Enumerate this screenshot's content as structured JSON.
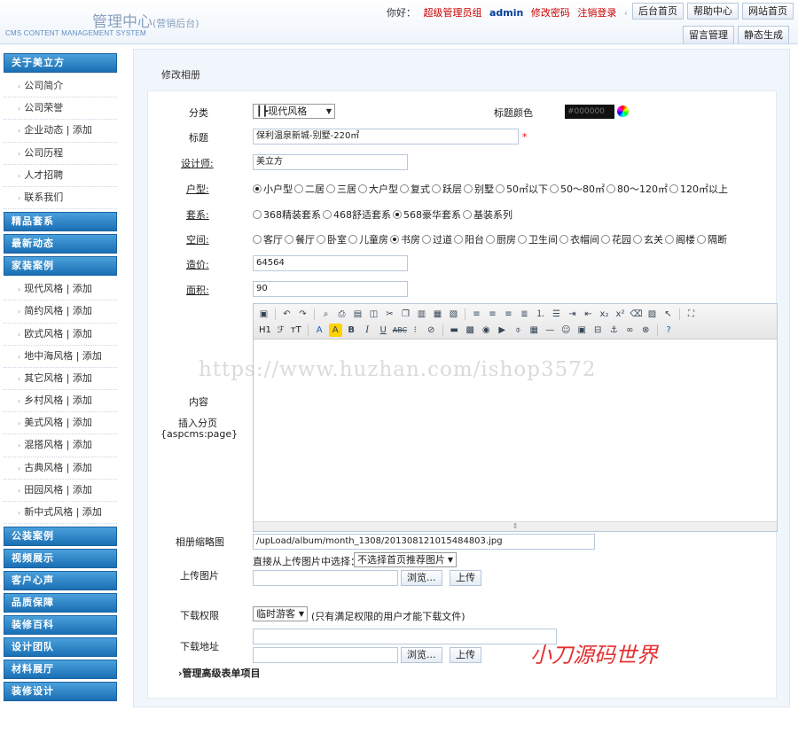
{
  "header": {
    "title": "管理中心",
    "title_sub": "(营销后台)",
    "title_en": "CMS CONTENT MANAGEMENT SYSTEM",
    "greeting": "你好：",
    "user_group": "超级管理员组",
    "user_name": "admin",
    "change_password": "修改密码",
    "logout": "注销登录",
    "top_buttons": [
      "后台首页",
      "帮助中心",
      "网站首页"
    ],
    "sub_buttons": [
      "留言管理",
      "静态生成"
    ]
  },
  "sidebar": {
    "groups": [
      {
        "title": "关于美立方",
        "items": [
          "公司简介",
          "公司荣誉",
          "企业动态 | 添加",
          "公司历程",
          "人才招聘",
          "联系我们"
        ]
      },
      {
        "title": "精品套系",
        "items": []
      },
      {
        "title": "最新动态",
        "items": []
      },
      {
        "title": "家装案例",
        "items": [
          "现代风格 | 添加",
          "简约风格 | 添加",
          "欧式风格 | 添加",
          "地中海风格 | 添加",
          "其它风格 | 添加",
          "乡村风格 | 添加",
          "美式风格 | 添加",
          "混搭风格 | 添加",
          "古典风格 | 添加",
          "田园风格 | 添加",
          "新中式风格 | 添加"
        ]
      },
      {
        "title": "公装案例",
        "items": []
      },
      {
        "title": "视频展示",
        "items": []
      },
      {
        "title": "客户心声",
        "items": []
      },
      {
        "title": "品质保障",
        "items": []
      },
      {
        "title": "装修百科",
        "items": []
      },
      {
        "title": "设计团队",
        "items": []
      },
      {
        "title": "材料展厅",
        "items": []
      },
      {
        "title": "装修设计",
        "items": []
      }
    ]
  },
  "form": {
    "page_title": "修改相册",
    "category_label": "分类",
    "category_value": "┃┣现代风格",
    "title_color_label": "标题颜色",
    "title_color_value": "#000000",
    "title_label": "标题",
    "title_value": "保利温泉新城-别墅-220㎡",
    "required_mark": "*",
    "designer_label": "设计师:",
    "designer_value": "美立方",
    "house_type_label": "户型:",
    "house_types": [
      "小户型",
      "二居",
      "三居",
      "大户型",
      "复式",
      "跃层",
      "别墅",
      "50㎡以下",
      "50～80㎡",
      "80～120㎡",
      "120㎡以上"
    ],
    "house_type_selected": 0,
    "package_label": "套系:",
    "packages": [
      "368精装套系",
      "468舒适套系",
      "568豪华套系",
      "基装系列"
    ],
    "package_selected": 2,
    "space_label": "空间:",
    "spaces": [
      "客厅",
      "餐厅",
      "卧室",
      "儿童房",
      "书房",
      "过道",
      "阳台",
      "厨房",
      "卫生间",
      "衣帽间",
      "花园",
      "玄关",
      "阁楼",
      "隔断"
    ],
    "space_selected": 4,
    "price_label": "造价:",
    "price_value": "64564",
    "area_label": "面积:",
    "area_value": "90",
    "content_label": "内容",
    "insert_page_label": "插入分页",
    "insert_page_code": "{aspcms:page}",
    "thumb_label": "相册缩略图",
    "thumb_value": "/upLoad/album/month_1308/201308121015484803.jpg",
    "choose_from_upload": "直接从上传图片中选择：",
    "choose_select_value": "不选择首页推荐图片",
    "upload_image_label": "上传图片",
    "browse": "浏览...",
    "upload": "上传",
    "download_perm_label": "下载权限",
    "download_perm_value": "临时游客",
    "download_perm_note": "(只有满足权限的用户才能下载文件)",
    "download_url_label": "下载地址",
    "advanced": "管理高级表单项目"
  },
  "editor": {
    "heading_btn": "H1",
    "font_btn": "ℱ",
    "size_btn": "тT"
  },
  "watermark": {
    "url": "https://www.huzhan.com/ishop3572",
    "sign": "小刀源码世界"
  }
}
